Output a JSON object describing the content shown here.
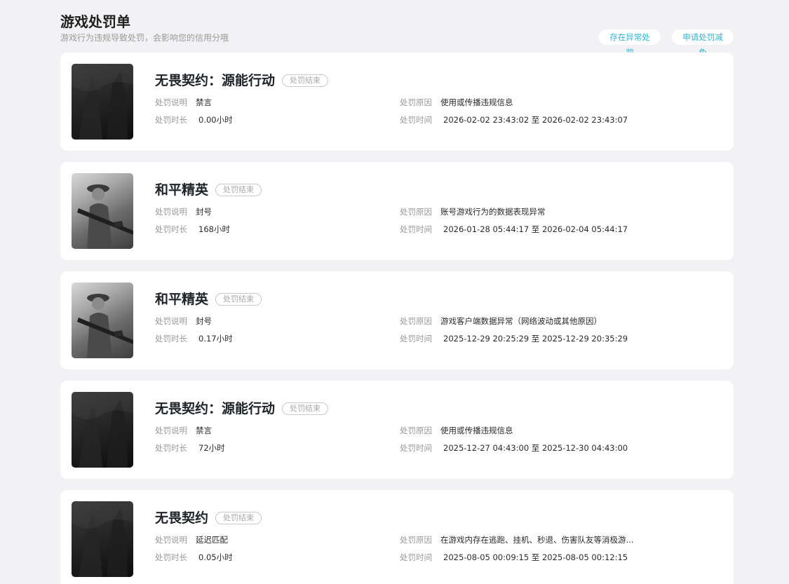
{
  "header": {
    "title": "游戏处罚单",
    "subtitle": "游戏行为违规导致处罚，会影响您的信用分哦",
    "btn_abnormal": "存在异常处罚",
    "btn_reduce": "申请处罚减免"
  },
  "labels": {
    "desc": "处罚说明",
    "duration": "处罚时长",
    "reason": "处罚原因",
    "time": "处罚时间"
  },
  "cards": [
    {
      "game": "无畏契约：源能行动",
      "status": "处罚结束",
      "desc": "禁言",
      "duration": "0.00小时",
      "reason": "使用或传播违规信息",
      "time": "2026-02-02 23:43:02 至 2026-02-02 23:43:07",
      "thumb": "dark-game-cover-icon"
    },
    {
      "game": "和平精英",
      "status": "处罚结束",
      "desc": "封号",
      "duration": "168小时",
      "reason": "账号游戏行为的数据表现异常",
      "time": "2026-01-28 05:44:17 至 2026-02-04 05:44:17",
      "thumb": "soldier-game-cover-icon"
    },
    {
      "game": "和平精英",
      "status": "处罚结束",
      "desc": "封号",
      "duration": "0.17小时",
      "reason": "游戏客户端数据异常（网络波动或其他原因）",
      "time": "2025-12-29 20:25:29 至 2025-12-29 20:35:29",
      "thumb": "soldier-game-cover-icon"
    },
    {
      "game": "无畏契约：源能行动",
      "status": "处罚结束",
      "desc": "禁言",
      "duration": "72小时",
      "reason": "使用或传播违规信息",
      "time": "2025-12-27 04:43:00 至 2025-12-30 04:43:00",
      "thumb": "dark-game-cover-icon"
    },
    {
      "game": "无畏契约",
      "status": "处罚结束",
      "desc": "延迟匹配",
      "duration": "0.05小时",
      "reason": "在游戏内存在逃跑、挂机、秒退、伤害队友等消极游...",
      "time": "2025-08-05 00:09:15 至 2025-08-05 00:12:15",
      "thumb": "dark-game-cover-icon"
    }
  ]
}
